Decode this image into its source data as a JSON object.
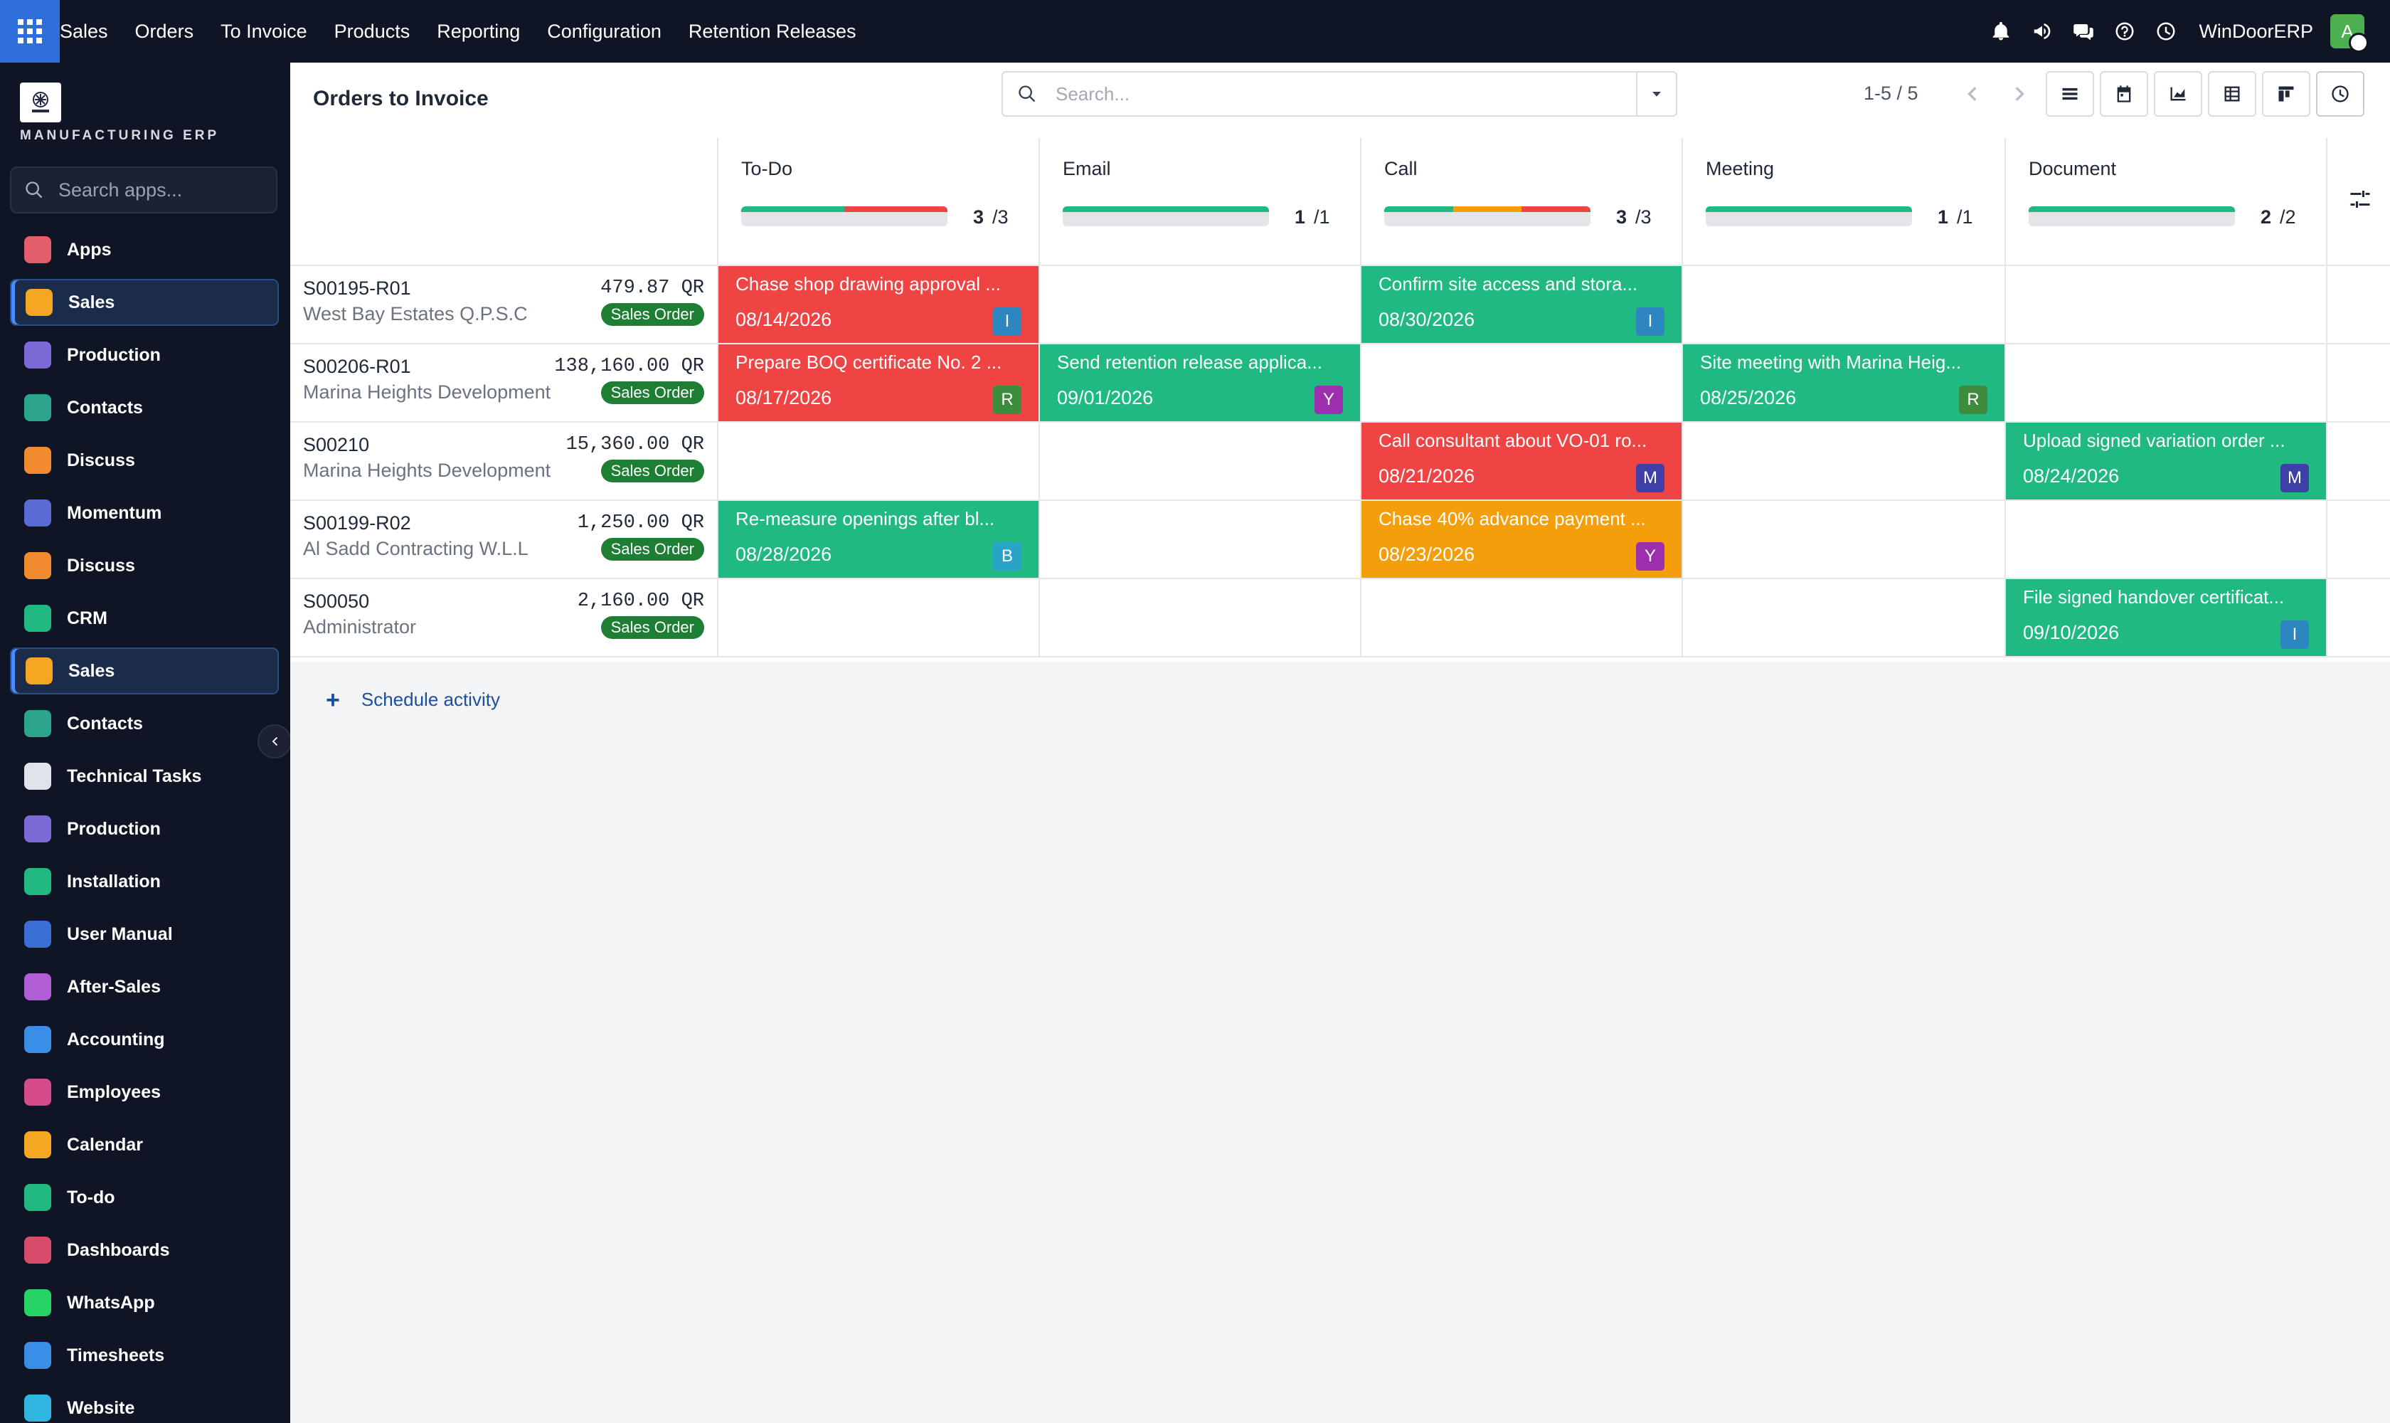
{
  "topbar": {
    "nav": [
      "Sales",
      "Orders",
      "To Invoice",
      "Products",
      "Reporting",
      "Configuration",
      "Retention Releases"
    ],
    "company": "WinDoorERP",
    "avatar_letter": "A"
  },
  "sidebar": {
    "brand_text": "MANUFACTURING ERP",
    "search_placeholder": "Search apps...",
    "items": [
      {
        "label": "Apps",
        "color": "#e35d6a"
      },
      {
        "label": "Sales",
        "color": "#f5a623"
      },
      {
        "label": "Production",
        "color": "#7c6bd6"
      },
      {
        "label": "Contacts",
        "color": "#2aa48b"
      },
      {
        "label": "Discuss",
        "color": "#f28b30"
      },
      {
        "label": "Momentum",
        "color": "#5b6bd6"
      },
      {
        "label": "Discuss",
        "color": "#f28b30"
      },
      {
        "label": "CRM",
        "color": "#1fb981"
      },
      {
        "label": "Sales",
        "color": "#f5a623"
      },
      {
        "label": "Contacts",
        "color": "#2aa48b"
      },
      {
        "label": "Technical Tasks",
        "color": "#dfe3ea"
      },
      {
        "label": "Production",
        "color": "#7c6bd6"
      },
      {
        "label": "Installation",
        "color": "#1fb981"
      },
      {
        "label": "User Manual",
        "color": "#3b6fd6"
      },
      {
        "label": "After-Sales",
        "color": "#b05dd6"
      },
      {
        "label": "Accounting",
        "color": "#3a8ee6"
      },
      {
        "label": "Employees",
        "color": "#d64c8a"
      },
      {
        "label": "Calendar",
        "color": "#f5a623"
      },
      {
        "label": "To-do",
        "color": "#1fb981"
      },
      {
        "label": "Dashboards",
        "color": "#d64c6a"
      },
      {
        "label": "WhatsApp",
        "color": "#25d366"
      },
      {
        "label": "Timesheets",
        "color": "#3a8ee6"
      },
      {
        "label": "Website",
        "color": "#2fb6e0"
      }
    ]
  },
  "header": {
    "title": "Orders to Invoice",
    "search_placeholder": "Search...",
    "pager": "1-5 / 5"
  },
  "columns": [
    {
      "name": "To-Do",
      "done": "3",
      "total": "/3",
      "segments": [
        {
          "color": "#1fb981",
          "pct": 50
        },
        {
          "color": "#ef4444",
          "pct": 50
        }
      ]
    },
    {
      "name": "Email",
      "done": "1",
      "total": "/1",
      "segments": [
        {
          "color": "#1fb981",
          "pct": 100
        }
      ]
    },
    {
      "name": "Call",
      "done": "3",
      "total": "/3",
      "segments": [
        {
          "color": "#1fb981",
          "pct": 33.3
        },
        {
          "color": "#f59e0b",
          "pct": 33.3
        },
        {
          "color": "#ef4444",
          "pct": 33.4
        }
      ]
    },
    {
      "name": "Meeting",
      "done": "1",
      "total": "/1",
      "segments": [
        {
          "color": "#1fb981",
          "pct": 100
        }
      ]
    },
    {
      "name": "Document",
      "done": "2",
      "total": "/2",
      "segments": [
        {
          "color": "#1fb981",
          "pct": 100
        }
      ]
    }
  ],
  "records": [
    {
      "id": "S00195-R01",
      "partner": "West Bay Estates Q.P.S.C",
      "amount": "479.87 QR",
      "badge": "Sales Order",
      "activities": [
        {
          "col": 0,
          "title": "Chase shop drawing approval ...",
          "date": "08/14/2026",
          "status": "red",
          "avatar": "I",
          "avatar_color": "#2e86c1"
        },
        {
          "col": 2,
          "title": "Confirm site access and stora...",
          "date": "08/30/2026",
          "status": "green",
          "avatar": "I",
          "avatar_color": "#2e86c1"
        }
      ]
    },
    {
      "id": "S00206-R01",
      "partner": "Marina Heights Development",
      "amount": "138,160.00 QR",
      "badge": "Sales Order",
      "activities": [
        {
          "col": 0,
          "title": "Prepare BOQ certificate No. 2 ...",
          "date": "08/17/2026",
          "status": "red",
          "avatar": "R",
          "avatar_color": "#3d8b3d"
        },
        {
          "col": 1,
          "title": "Send retention release applica...",
          "date": "09/01/2026",
          "status": "green",
          "avatar": "Y",
          "avatar_color": "#9b2fae"
        },
        {
          "col": 3,
          "title": "Site meeting with Marina Heig...",
          "date": "08/25/2026",
          "status": "green",
          "avatar": "R",
          "avatar_color": "#3d8b3d"
        }
      ]
    },
    {
      "id": "S00210",
      "partner": "Marina Heights Development",
      "amount": "15,360.00 QR",
      "badge": "Sales Order",
      "activities": [
        {
          "col": 2,
          "title": "Call consultant about VO-01 ro...",
          "date": "08/21/2026",
          "status": "red",
          "avatar": "M",
          "avatar_color": "#3f3fa8"
        },
        {
          "col": 4,
          "title": "Upload signed variation order ...",
          "date": "08/24/2026",
          "status": "green",
          "avatar": "M",
          "avatar_color": "#3f3fa8"
        }
      ]
    },
    {
      "id": "S00199-R02",
      "partner": "Al Sadd Contracting W.L.L",
      "amount": "1,250.00 QR",
      "badge": "Sales Order",
      "activities": [
        {
          "col": 0,
          "title": "Re-measure openings after bl...",
          "date": "08/28/2026",
          "status": "green",
          "avatar": "B",
          "avatar_color": "#2aa3c9"
        },
        {
          "col": 2,
          "title": "Chase 40% advance payment ...",
          "date": "08/23/2026",
          "status": "orange",
          "avatar": "Y",
          "avatar_color": "#9b2fae"
        }
      ]
    },
    {
      "id": "S00050",
      "partner": "Administrator",
      "amount": "2,160.00 QR",
      "badge": "Sales Order",
      "activities": [
        {
          "col": 4,
          "title": "File signed handover certificat...",
          "date": "09/10/2026",
          "status": "green",
          "avatar": "I",
          "avatar_color": "#2e86c1"
        }
      ]
    }
  ],
  "footer": {
    "schedule_label": "Schedule activity"
  }
}
